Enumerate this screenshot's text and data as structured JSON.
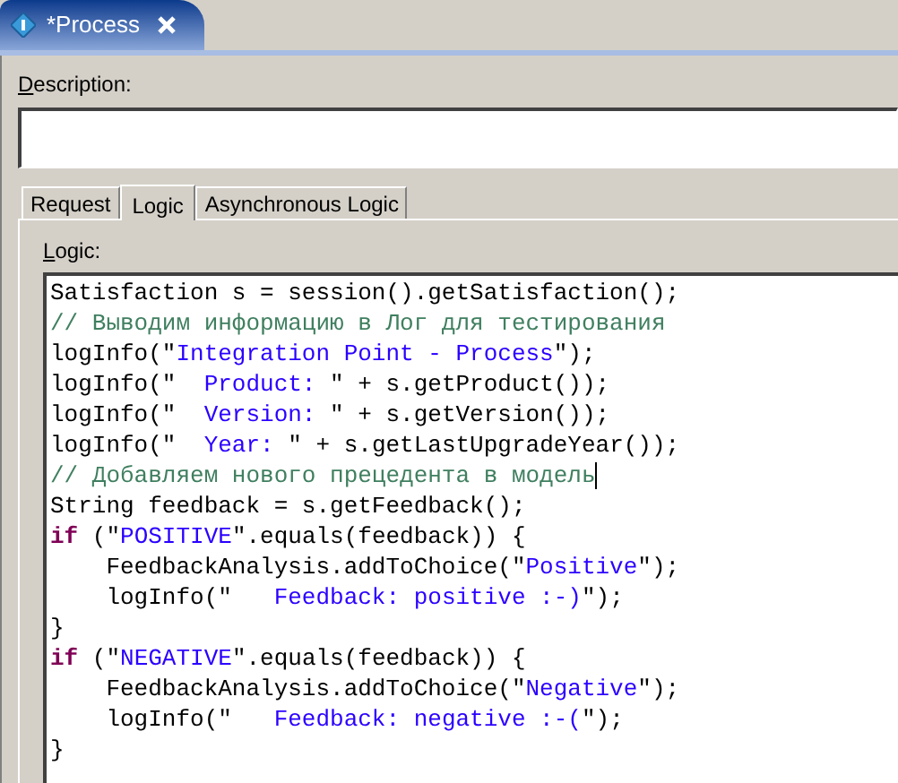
{
  "editor_tab": {
    "title": "*Process",
    "selected": true
  },
  "description": {
    "label": "Description:"
  },
  "tabs": [
    {
      "label": "Request",
      "selected": false
    },
    {
      "label": "Logic",
      "selected": true
    },
    {
      "label": "Asynchronous Logic",
      "selected": false
    }
  ],
  "logic": {
    "label": "Logic:",
    "lines": [
      [
        {
          "kind": "plain",
          "text": "Satisfaction s = session().getSatisfaction();"
        }
      ],
      [
        {
          "kind": "comment",
          "text": "// Выводим информацию в Лог для тестирования"
        }
      ],
      [
        {
          "kind": "plain",
          "text": "logInfo(\""
        },
        {
          "kind": "string",
          "text": "Integration Point - Process"
        },
        {
          "kind": "plain",
          "text": "\");"
        }
      ],
      [
        {
          "kind": "plain",
          "text": "logInfo(\"  "
        },
        {
          "kind": "string",
          "text": "Product: "
        },
        {
          "kind": "plain",
          "text": "\" + s.getProduct());"
        }
      ],
      [
        {
          "kind": "plain",
          "text": "logInfo(\"  "
        },
        {
          "kind": "string",
          "text": "Version: "
        },
        {
          "kind": "plain",
          "text": "\" + s.getVersion());"
        }
      ],
      [
        {
          "kind": "plain",
          "text": "logInfo(\"  "
        },
        {
          "kind": "string",
          "text": "Year: "
        },
        {
          "kind": "plain",
          "text": "\" + s.getLastUpgradeYear());"
        }
      ],
      [
        {
          "kind": "comment",
          "text": "// Добавляем нового прецедента в модель"
        },
        {
          "kind": "cursor"
        }
      ],
      [
        {
          "kind": "plain",
          "text": "String feedback = s.getFeedback();"
        }
      ],
      [
        {
          "kind": "keyword",
          "text": "if"
        },
        {
          "kind": "plain",
          "text": " (\""
        },
        {
          "kind": "string",
          "text": "POSITIVE"
        },
        {
          "kind": "plain",
          "text": "\".equals(feedback)) {"
        }
      ],
      [
        {
          "kind": "plain",
          "text": "    FeedbackAnalysis.addToChoice(\""
        },
        {
          "kind": "string",
          "text": "Positive"
        },
        {
          "kind": "plain",
          "text": "\");"
        }
      ],
      [
        {
          "kind": "plain",
          "text": "    logInfo(\"   "
        },
        {
          "kind": "string",
          "text": "Feedback: positive :-)"
        },
        {
          "kind": "plain",
          "text": "\");"
        }
      ],
      [
        {
          "kind": "plain",
          "text": "}"
        }
      ],
      [
        {
          "kind": "keyword",
          "text": "if"
        },
        {
          "kind": "plain",
          "text": " (\""
        },
        {
          "kind": "string",
          "text": "NEGATIVE"
        },
        {
          "kind": "plain",
          "text": "\".equals(feedback)) {"
        }
      ],
      [
        {
          "kind": "plain",
          "text": "    FeedbackAnalysis.addToChoice(\""
        },
        {
          "kind": "string",
          "text": "Negative"
        },
        {
          "kind": "plain",
          "text": "\");"
        }
      ],
      [
        {
          "kind": "plain",
          "text": "    logInfo(\"   "
        },
        {
          "kind": "string",
          "text": "Feedback: negative :-("
        },
        {
          "kind": "plain",
          "text": "\");"
        }
      ],
      [
        {
          "kind": "plain",
          "text": "}"
        }
      ]
    ]
  }
}
